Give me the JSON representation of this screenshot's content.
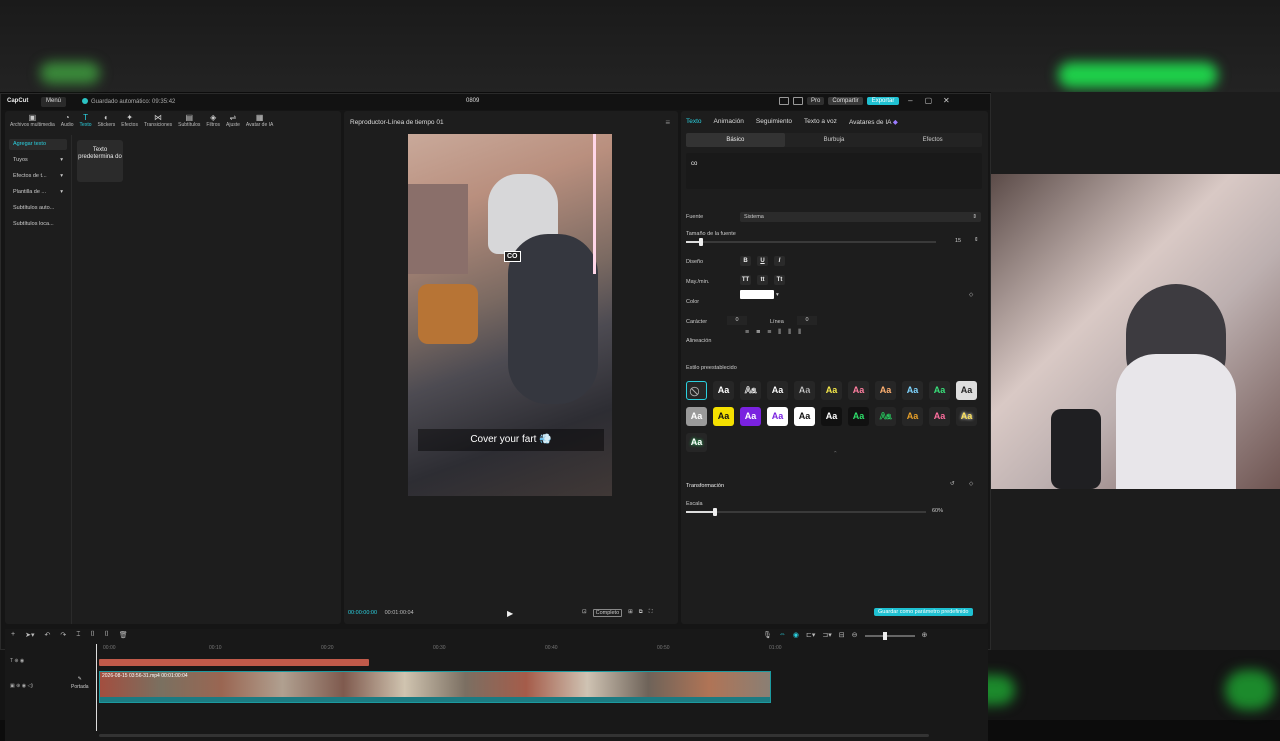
{
  "titlebar": {
    "app_name": "CapCut",
    "menu_label": "Menú",
    "autosave": "Guardado automático: 09:35:42",
    "project_title": "0809",
    "pro_label": "Pro",
    "share_label": "Compartir",
    "export_label": "Exportar"
  },
  "toolbar": {
    "items": [
      "Archivos multimedia",
      "Audio",
      "Texto",
      "Stickers",
      "Efectos",
      "Transiciones",
      "Subtítulos",
      "Filtros",
      "Ajuste",
      "Avatar de IA"
    ],
    "active": "Texto"
  },
  "leftnav": {
    "items": [
      "Agregar texto",
      "Tuyos",
      "Efectos de t...",
      "Plantilla de ...",
      "Subtítulos auto...",
      "Subtítulos loca..."
    ]
  },
  "text_card": {
    "label": "Texto predetermina do"
  },
  "player": {
    "title": "Reproductor-Línea de tiempo 01",
    "overlay_label": "CO",
    "caption": "Cover your fart 💨",
    "current_time": "00:00:00:00",
    "total_time": "00:01:00:04",
    "full_label": "Completo"
  },
  "right": {
    "tabs": [
      "Texto",
      "Animación",
      "Seguimiento",
      "Texto a voz",
      "Avatares de IA"
    ],
    "subtabs": [
      "Básico",
      "Burbuja",
      "Efectos"
    ],
    "text_value": "co",
    "font_label": "Fuente",
    "font_value": "Sistema",
    "size_label": "Tamaño de la fuente",
    "size_value": "15",
    "size_fraction": 0.06,
    "design_label": "Diseño",
    "case_label": "May./min.",
    "color_label": "Color",
    "color_value": "#ffffff",
    "char_label": "Carácter",
    "char_value": "0",
    "line_label": "Línea",
    "line_value": "0",
    "align_label": "Alineación",
    "preset_label": "Estilo preestablecido",
    "transform_label": "Transformación",
    "scale_label": "Escala",
    "scale_value": "60%",
    "save_default": "Guardar como parámetro predefinido"
  },
  "timeline": {
    "ruler": [
      "00:00",
      "00:10",
      "00:20",
      "00:30",
      "00:40",
      "00:50",
      "01:00"
    ],
    "clip_name": "2026-08-15 03:56-31.mp4",
    "clip_duration": "00:01:00:04",
    "cover_label": "Portada"
  },
  "colors": {
    "accent": "#2bd1e0",
    "brand": "#1fc1d2",
    "ai": "#9b7bff"
  }
}
